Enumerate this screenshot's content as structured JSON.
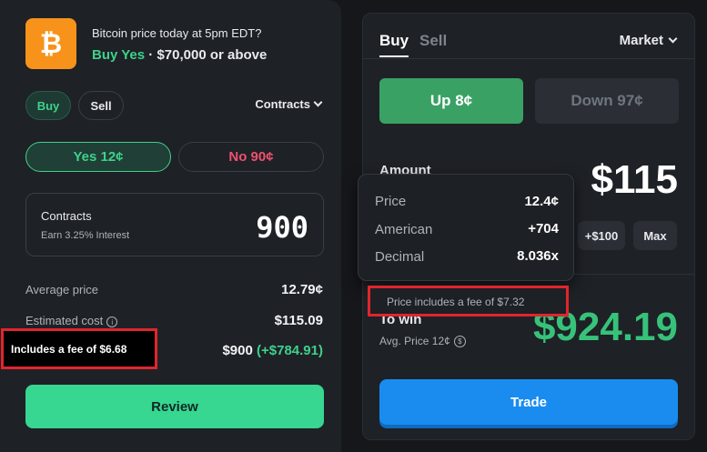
{
  "market": {
    "icon": "bitcoin-icon",
    "icon_glyph": "₿",
    "title": "Bitcoin price today at 5pm EDT?",
    "side_label": "Buy Yes",
    "separator": " · ",
    "condition": "$70,000 or above"
  },
  "left": {
    "buy_label": "Buy",
    "sell_label": "Sell",
    "mode_label": "Contracts",
    "yes_label": "Yes 12¢",
    "no_label": "No 90¢",
    "contracts_label": "Contracts",
    "interest_label": "Earn 3.25% Interest",
    "contracts_value": "900",
    "avg_price_label": "Average price",
    "avg_price_value": "12.79¢",
    "est_cost_label": "Estimated cost",
    "est_cost_value": "$115.09",
    "fee_note": "Includes a fee of $6.68",
    "payout_value": "$900",
    "payout_gain": "(+$784.91)",
    "review_label": "Review"
  },
  "right": {
    "tab_buy": "Buy",
    "tab_sell": "Sell",
    "order_type": "Market",
    "up_label": "Up 8¢",
    "down_label": "Down 97¢",
    "amount_label": "Amount",
    "amount_value": "$115",
    "quick_100": "+$100",
    "quick_max": "Max",
    "to_win_label": "To win",
    "avg_price_label": "Avg. Price 12¢",
    "payout_value": "$924.19",
    "trade_label": "Trade"
  },
  "tooltip": {
    "price_label": "Price",
    "price_value": "12.4¢",
    "american_label": "American",
    "american_value": "+704",
    "decimal_label": "Decimal",
    "decimal_value": "8.036x",
    "fee_note": "Price includes a fee of $7.32"
  },
  "colors": {
    "green": "#3fd18b",
    "red": "#f0506e",
    "blue": "#1a8cf0",
    "highlight_border": "#e0262c",
    "bitcoin_orange": "#f7931a"
  }
}
